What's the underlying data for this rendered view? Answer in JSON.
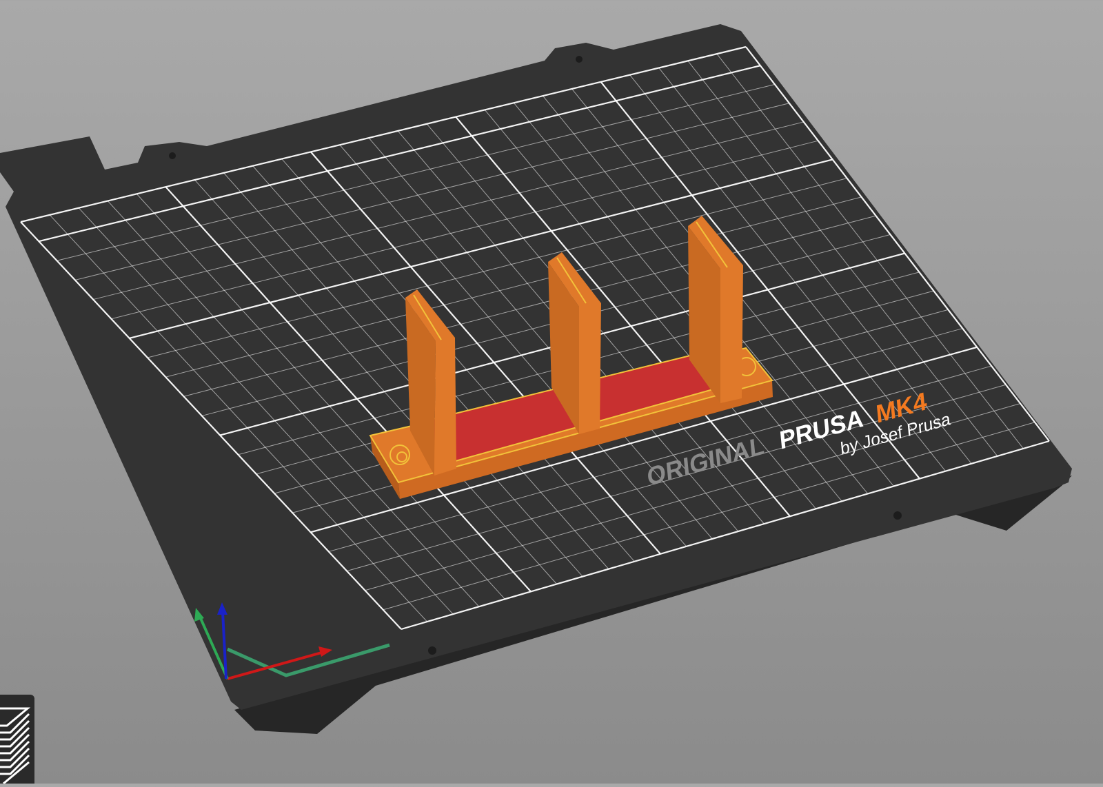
{
  "viewport": {
    "printer_bed": {
      "logo": {
        "line1_a": "ORIGINAL",
        "line1_b": "PRUSA",
        "line1_c": "MK4",
        "line2": "by Josef Prusa"
      },
      "colors": {
        "plate": "#333333",
        "grid": "#ffffff",
        "logo_grey": "#8a8a8a",
        "logo_orange": "#f47a20"
      }
    },
    "object": {
      "colors": {
        "body": "#e0792a",
        "body_dark": "#b85d1c",
        "top_surface": "#c83030",
        "edge": "#f2c23a"
      }
    },
    "axes": {
      "x_color": "#d01818",
      "y_color": "#2eaa55",
      "z_color": "#1a22c8"
    },
    "layers_button": {
      "icon": "layers-icon"
    }
  }
}
